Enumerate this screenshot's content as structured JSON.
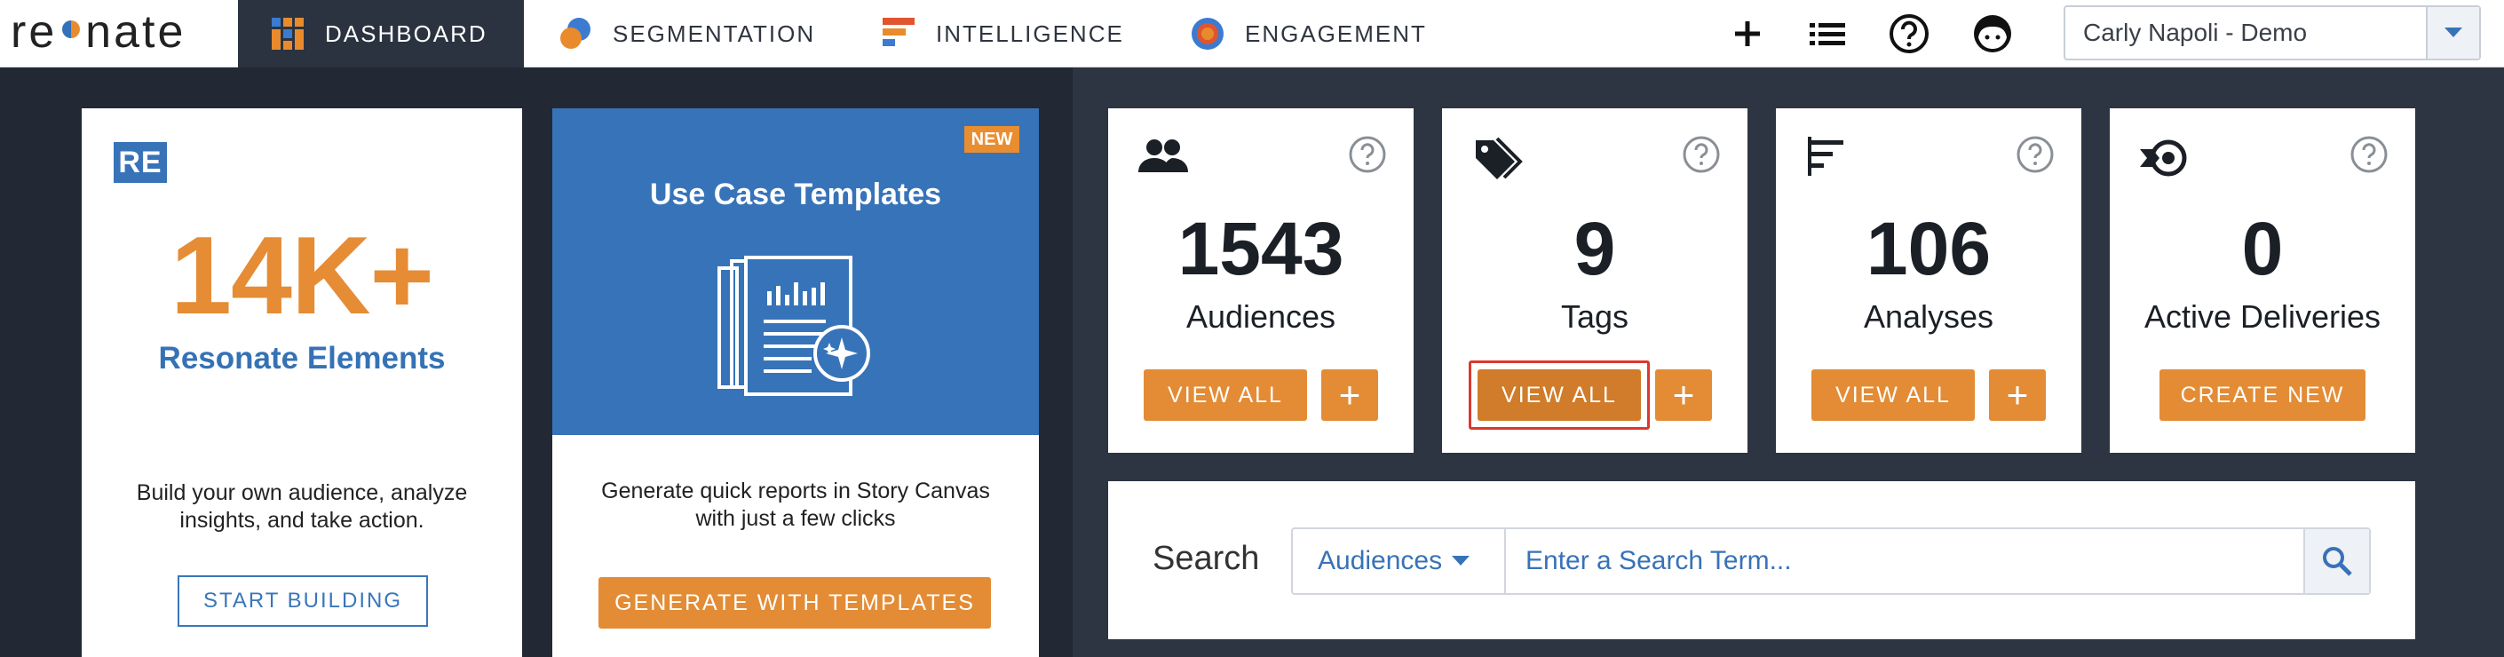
{
  "nav": {
    "logo_prefix": "re",
    "logo_o": "o",
    "logo_suffix": "nate",
    "tabs": [
      {
        "label": "DASHBOARD",
        "icon": "dashboard-grid-icon",
        "active": true
      },
      {
        "label": "SEGMENTATION",
        "icon": "segmentation-icon"
      },
      {
        "label": "INTELLIGENCE",
        "icon": "intelligence-bars-icon"
      },
      {
        "label": "ENGAGEMENT",
        "icon": "engagement-target-icon"
      }
    ],
    "actions": [
      "plus-icon",
      "list-icon",
      "help-icon",
      "avatar-icon"
    ],
    "user": "Carly Napoli - Demo"
  },
  "elements_card": {
    "badge": "RE",
    "stat": "14K+",
    "stat_label": "Resonate Elements",
    "description": "Build your own audience, analyze insights, and take action.",
    "button": "START BUILDING"
  },
  "templates_card": {
    "badge": "NEW",
    "title": "Use Case Templates",
    "description": "Generate quick reports in Story Canvas with just a few clicks",
    "button": "GENERATE WITH TEMPLATES"
  },
  "stats": [
    {
      "value": "1543",
      "label": "Audiences",
      "button": "VIEW ALL",
      "plus": "+",
      "icon": "people-icon"
    },
    {
      "value": "9",
      "label": "Tags",
      "button": "VIEW ALL",
      "plus": "+",
      "icon": "tag-icon"
    },
    {
      "value": "106",
      "label": "Analyses",
      "button": "VIEW ALL",
      "plus": "+",
      "icon": "analyses-bars-icon"
    },
    {
      "value": "0",
      "label": "Active Deliveries",
      "button": "CREATE NEW",
      "icon": "delivery-icon"
    }
  ],
  "search": {
    "label": "Search",
    "scope": "Audiences",
    "placeholder": "Enter a Search Term..."
  },
  "colors": {
    "accent_orange": "#e38c35",
    "brand_blue": "#3773b8",
    "nav_dark": "#2b3340",
    "highlight_red": "#d9392e"
  }
}
